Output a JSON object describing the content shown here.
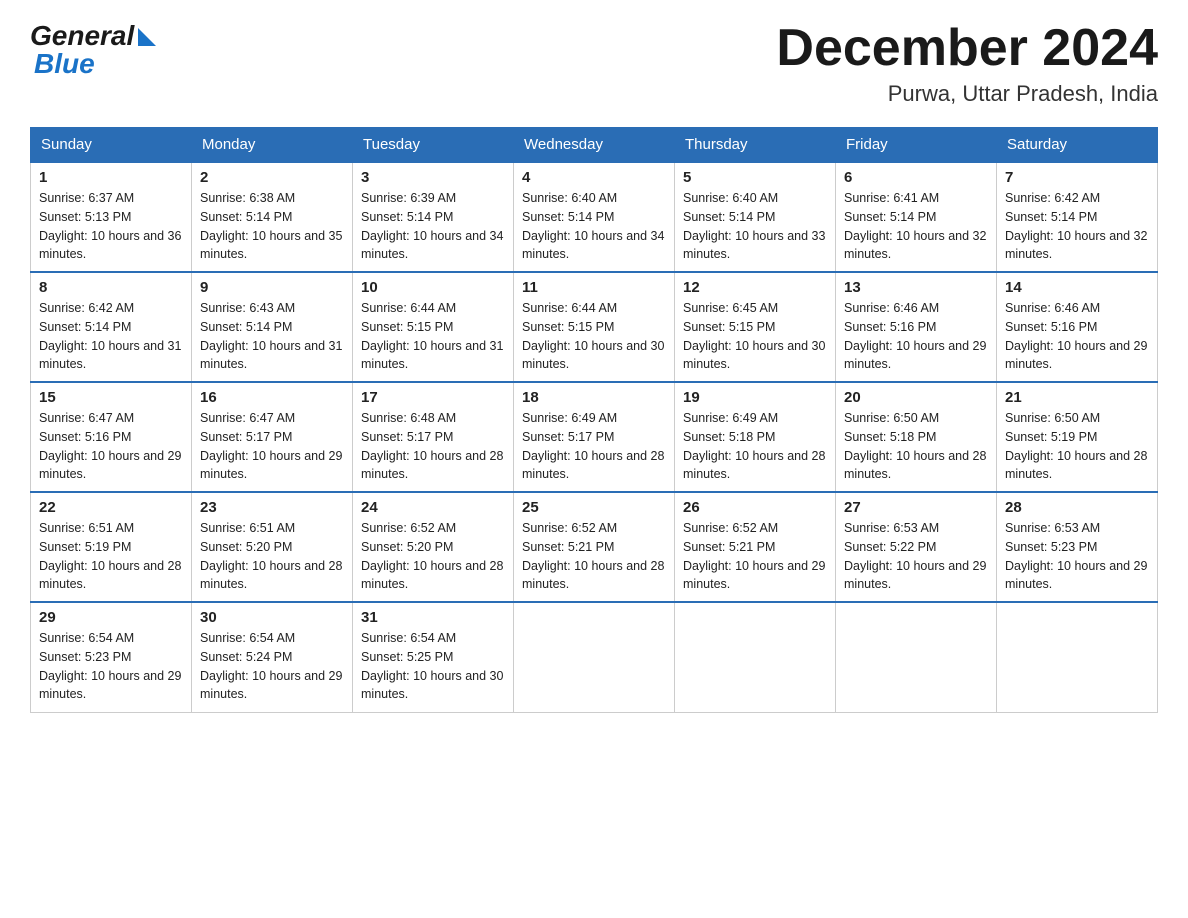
{
  "header": {
    "logo_general": "General",
    "logo_blue": "Blue",
    "month_title": "December 2024",
    "location": "Purwa, Uttar Pradesh, India"
  },
  "days_of_week": [
    "Sunday",
    "Monday",
    "Tuesday",
    "Wednesday",
    "Thursday",
    "Friday",
    "Saturday"
  ],
  "weeks": [
    [
      {
        "day": "1",
        "sunrise": "6:37 AM",
        "sunset": "5:13 PM",
        "daylight": "10 hours and 36 minutes."
      },
      {
        "day": "2",
        "sunrise": "6:38 AM",
        "sunset": "5:14 PM",
        "daylight": "10 hours and 35 minutes."
      },
      {
        "day": "3",
        "sunrise": "6:39 AM",
        "sunset": "5:14 PM",
        "daylight": "10 hours and 34 minutes."
      },
      {
        "day": "4",
        "sunrise": "6:40 AM",
        "sunset": "5:14 PM",
        "daylight": "10 hours and 34 minutes."
      },
      {
        "day": "5",
        "sunrise": "6:40 AM",
        "sunset": "5:14 PM",
        "daylight": "10 hours and 33 minutes."
      },
      {
        "day": "6",
        "sunrise": "6:41 AM",
        "sunset": "5:14 PM",
        "daylight": "10 hours and 32 minutes."
      },
      {
        "day": "7",
        "sunrise": "6:42 AM",
        "sunset": "5:14 PM",
        "daylight": "10 hours and 32 minutes."
      }
    ],
    [
      {
        "day": "8",
        "sunrise": "6:42 AM",
        "sunset": "5:14 PM",
        "daylight": "10 hours and 31 minutes."
      },
      {
        "day": "9",
        "sunrise": "6:43 AM",
        "sunset": "5:14 PM",
        "daylight": "10 hours and 31 minutes."
      },
      {
        "day": "10",
        "sunrise": "6:44 AM",
        "sunset": "5:15 PM",
        "daylight": "10 hours and 31 minutes."
      },
      {
        "day": "11",
        "sunrise": "6:44 AM",
        "sunset": "5:15 PM",
        "daylight": "10 hours and 30 minutes."
      },
      {
        "day": "12",
        "sunrise": "6:45 AM",
        "sunset": "5:15 PM",
        "daylight": "10 hours and 30 minutes."
      },
      {
        "day": "13",
        "sunrise": "6:46 AM",
        "sunset": "5:16 PM",
        "daylight": "10 hours and 29 minutes."
      },
      {
        "day": "14",
        "sunrise": "6:46 AM",
        "sunset": "5:16 PM",
        "daylight": "10 hours and 29 minutes."
      }
    ],
    [
      {
        "day": "15",
        "sunrise": "6:47 AM",
        "sunset": "5:16 PM",
        "daylight": "10 hours and 29 minutes."
      },
      {
        "day": "16",
        "sunrise": "6:47 AM",
        "sunset": "5:17 PM",
        "daylight": "10 hours and 29 minutes."
      },
      {
        "day": "17",
        "sunrise": "6:48 AM",
        "sunset": "5:17 PM",
        "daylight": "10 hours and 28 minutes."
      },
      {
        "day": "18",
        "sunrise": "6:49 AM",
        "sunset": "5:17 PM",
        "daylight": "10 hours and 28 minutes."
      },
      {
        "day": "19",
        "sunrise": "6:49 AM",
        "sunset": "5:18 PM",
        "daylight": "10 hours and 28 minutes."
      },
      {
        "day": "20",
        "sunrise": "6:50 AM",
        "sunset": "5:18 PM",
        "daylight": "10 hours and 28 minutes."
      },
      {
        "day": "21",
        "sunrise": "6:50 AM",
        "sunset": "5:19 PM",
        "daylight": "10 hours and 28 minutes."
      }
    ],
    [
      {
        "day": "22",
        "sunrise": "6:51 AM",
        "sunset": "5:19 PM",
        "daylight": "10 hours and 28 minutes."
      },
      {
        "day": "23",
        "sunrise": "6:51 AM",
        "sunset": "5:20 PM",
        "daylight": "10 hours and 28 minutes."
      },
      {
        "day": "24",
        "sunrise": "6:52 AM",
        "sunset": "5:20 PM",
        "daylight": "10 hours and 28 minutes."
      },
      {
        "day": "25",
        "sunrise": "6:52 AM",
        "sunset": "5:21 PM",
        "daylight": "10 hours and 28 minutes."
      },
      {
        "day": "26",
        "sunrise": "6:52 AM",
        "sunset": "5:21 PM",
        "daylight": "10 hours and 29 minutes."
      },
      {
        "day": "27",
        "sunrise": "6:53 AM",
        "sunset": "5:22 PM",
        "daylight": "10 hours and 29 minutes."
      },
      {
        "day": "28",
        "sunrise": "6:53 AM",
        "sunset": "5:23 PM",
        "daylight": "10 hours and 29 minutes."
      }
    ],
    [
      {
        "day": "29",
        "sunrise": "6:54 AM",
        "sunset": "5:23 PM",
        "daylight": "10 hours and 29 minutes."
      },
      {
        "day": "30",
        "sunrise": "6:54 AM",
        "sunset": "5:24 PM",
        "daylight": "10 hours and 29 minutes."
      },
      {
        "day": "31",
        "sunrise": "6:54 AM",
        "sunset": "5:25 PM",
        "daylight": "10 hours and 30 minutes."
      },
      null,
      null,
      null,
      null
    ]
  ]
}
